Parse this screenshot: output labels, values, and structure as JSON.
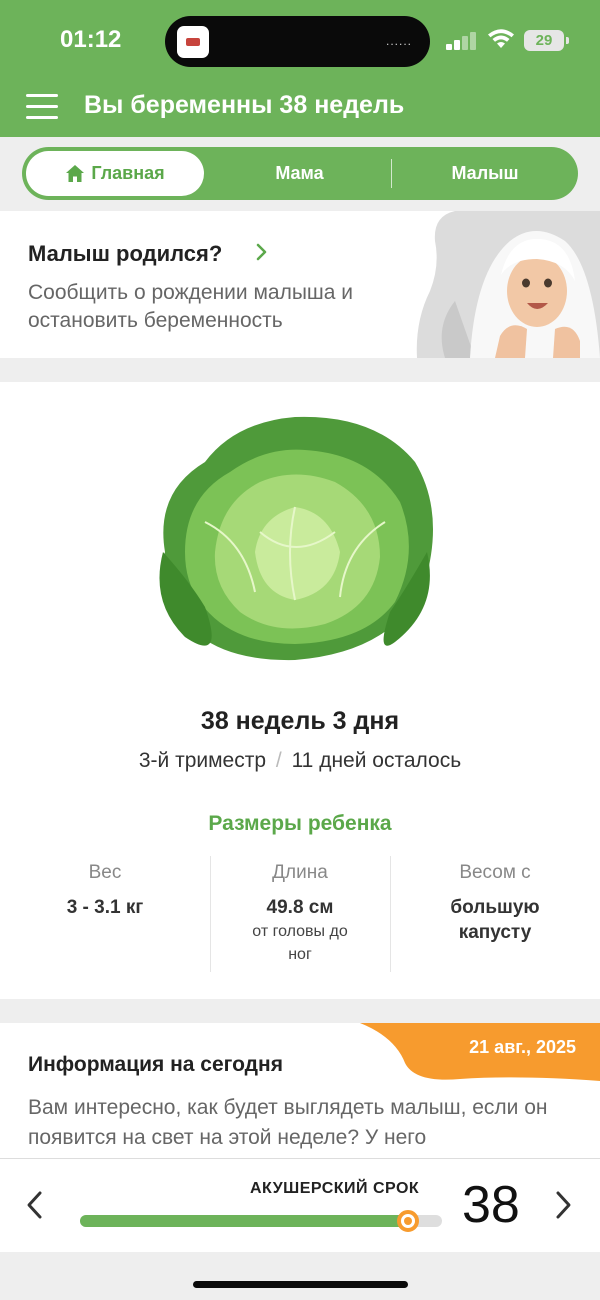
{
  "status_bar": {
    "time": "01:12",
    "battery": "29",
    "island_dots": "......"
  },
  "header": {
    "title": "Вы беременны 38 недель"
  },
  "tabs": [
    {
      "label": "Главная",
      "active": true,
      "icon": "home-icon"
    },
    {
      "label": "Мама",
      "active": false
    },
    {
      "label": "Малыш",
      "active": false
    }
  ],
  "born_card": {
    "title": "Малыш родился?",
    "text": "Сообщить о рождении малыша и остановить беременность"
  },
  "week_card": {
    "title": "38 недель 3 дня",
    "trimester": "3-й триместр",
    "separator": "/",
    "days_left": "11 дней осталось",
    "sizes_title": "Размеры ребенка",
    "weight": {
      "label": "Вес",
      "value": "3 - 3.1 кг"
    },
    "length": {
      "label": "Длина",
      "value": "49.8 см",
      "sub": "от головы до ног"
    },
    "compare": {
      "label": "Весом с",
      "value": "большую капусту"
    }
  },
  "info_card": {
    "date": "21 авг., 2025",
    "title": "Информация на сегодня",
    "text": "Вам интересно, как будет выглядеть малыш, если он появится на свет на этой неделе? У него"
  },
  "bottom_bar": {
    "label": "АКУШЕРСКИЙ СРОК",
    "week": "38",
    "progress_fraction": 0.905
  },
  "colors": {
    "brand_green": "#6db35a",
    "accent_orange": "#f79b2e"
  }
}
